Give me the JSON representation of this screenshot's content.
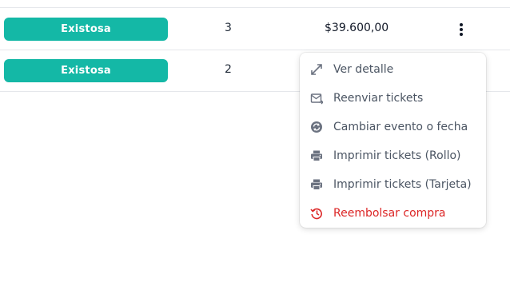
{
  "rows": [
    {
      "status": "Existosa",
      "quantity": "3",
      "amount": "$39.600,00"
    },
    {
      "status": "Existosa",
      "quantity": "2"
    }
  ],
  "menu": {
    "items": [
      {
        "label": "Ver detalle",
        "icon": "expand-icon"
      },
      {
        "label": "Reenviar tickets",
        "icon": "mail-forward-icon"
      },
      {
        "label": "Cambiar evento o fecha",
        "icon": "sync-icon"
      },
      {
        "label": "Imprimir tickets (Rollo)",
        "icon": "printer-icon"
      },
      {
        "label": "Imprimir tickets (Tarjeta)",
        "icon": "printer-icon"
      },
      {
        "label": "Reembolsar compra",
        "icon": "history-icon"
      }
    ]
  },
  "colors": {
    "badge": "#14b8a6",
    "danger": "#dc2626",
    "icon": "#6b7280"
  }
}
